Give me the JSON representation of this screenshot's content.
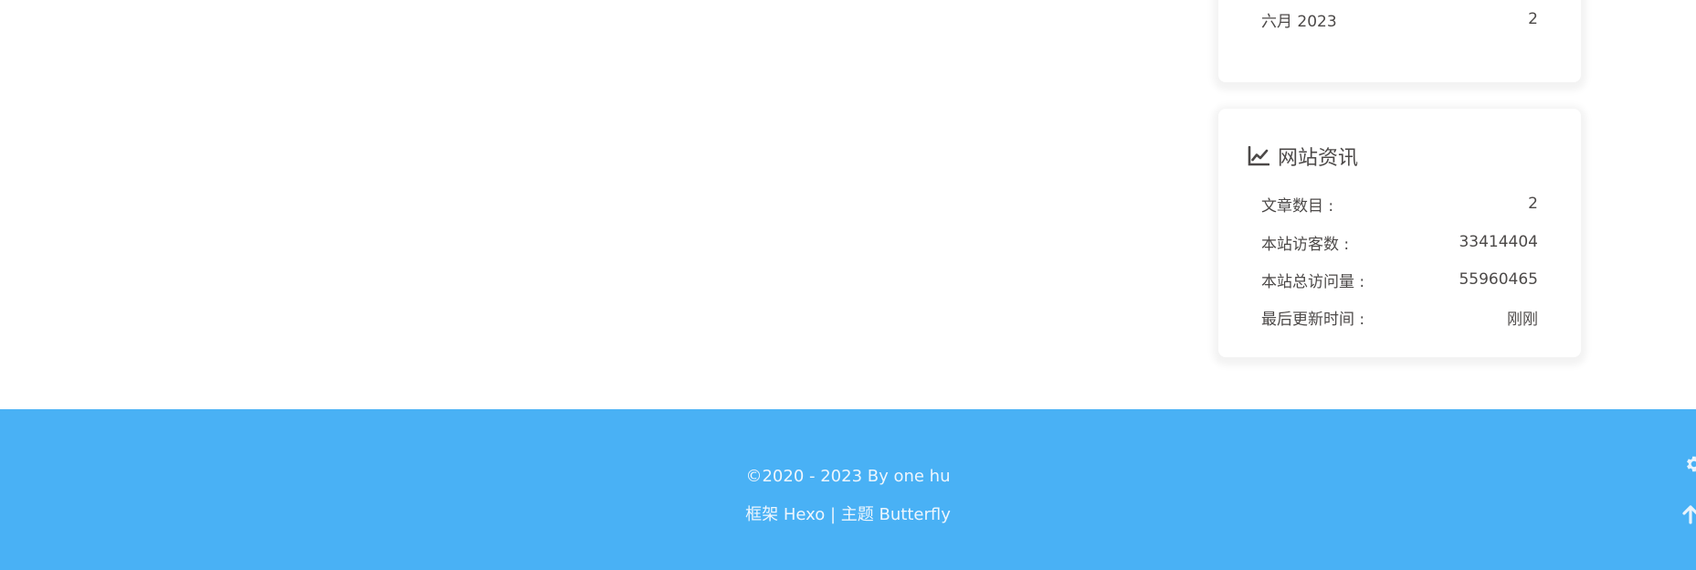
{
  "archives": {
    "items": [
      {
        "label": "六月 2023",
        "count": "2"
      }
    ]
  },
  "site_info": {
    "title": "网站资讯",
    "icon": "chart-line-icon",
    "rows": [
      {
        "label": "文章数目 :",
        "value": "2"
      },
      {
        "label": "本站访客数 :",
        "value": "33414404"
      },
      {
        "label": "本站总访问量 :",
        "value": "55960465"
      },
      {
        "label": "最后更新时间 :",
        "value": "刚刚"
      }
    ]
  },
  "footer": {
    "copyright": "©2020 - 2023 By one hu",
    "framework_prefix": "框架",
    "framework_name": "Hexo",
    "separator": "|",
    "theme_prefix": "主题",
    "theme_name": "Butterfly",
    "background_color": "#49b1f5"
  },
  "rightside": {
    "settings_icon": "gear-icon",
    "back_to_top_icon": "arrow-up-icon"
  }
}
